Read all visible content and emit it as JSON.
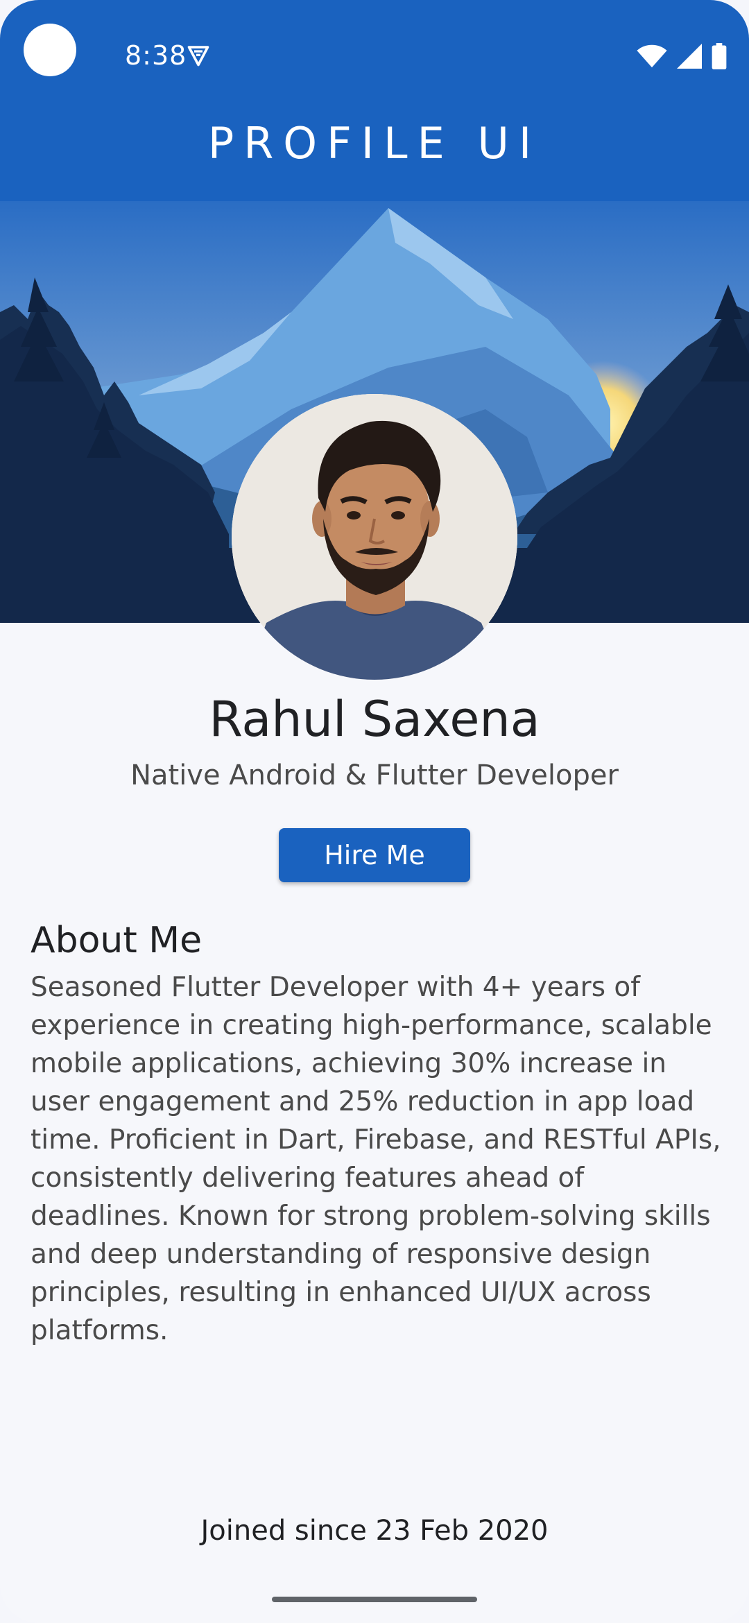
{
  "status_bar": {
    "time": "8:38",
    "icons": [
      "vpn-key-icon",
      "wifi-icon",
      "signal-icon",
      "battery-icon"
    ]
  },
  "app_bar": {
    "title": "PROFILE UI",
    "background": "#1a62bf"
  },
  "profile": {
    "name": "Rahul Saxena",
    "role": "Native Android & Flutter Developer",
    "hire_button": "Hire Me"
  },
  "about": {
    "heading": "About Me",
    "text": "Seasoned Flutter Developer with 4+ years of experience in creating high-performance, scalable mobile applications, achieving 30% increase in user engagement and 25% reduction in app load time. Proficient in Dart, Firebase, and RESTful APIs, consistently delivering features ahead of deadlines. Known for strong problem-solving skills and deep understanding of responsive design principles, resulting in enhanced UI/UX across platforms."
  },
  "footer": {
    "joined": "Joined since 23 Feb 2020"
  },
  "colors": {
    "primary": "#1a62bf",
    "background": "#f6f7fb",
    "text_dark": "#202124",
    "text_muted": "#4a4a4a"
  }
}
